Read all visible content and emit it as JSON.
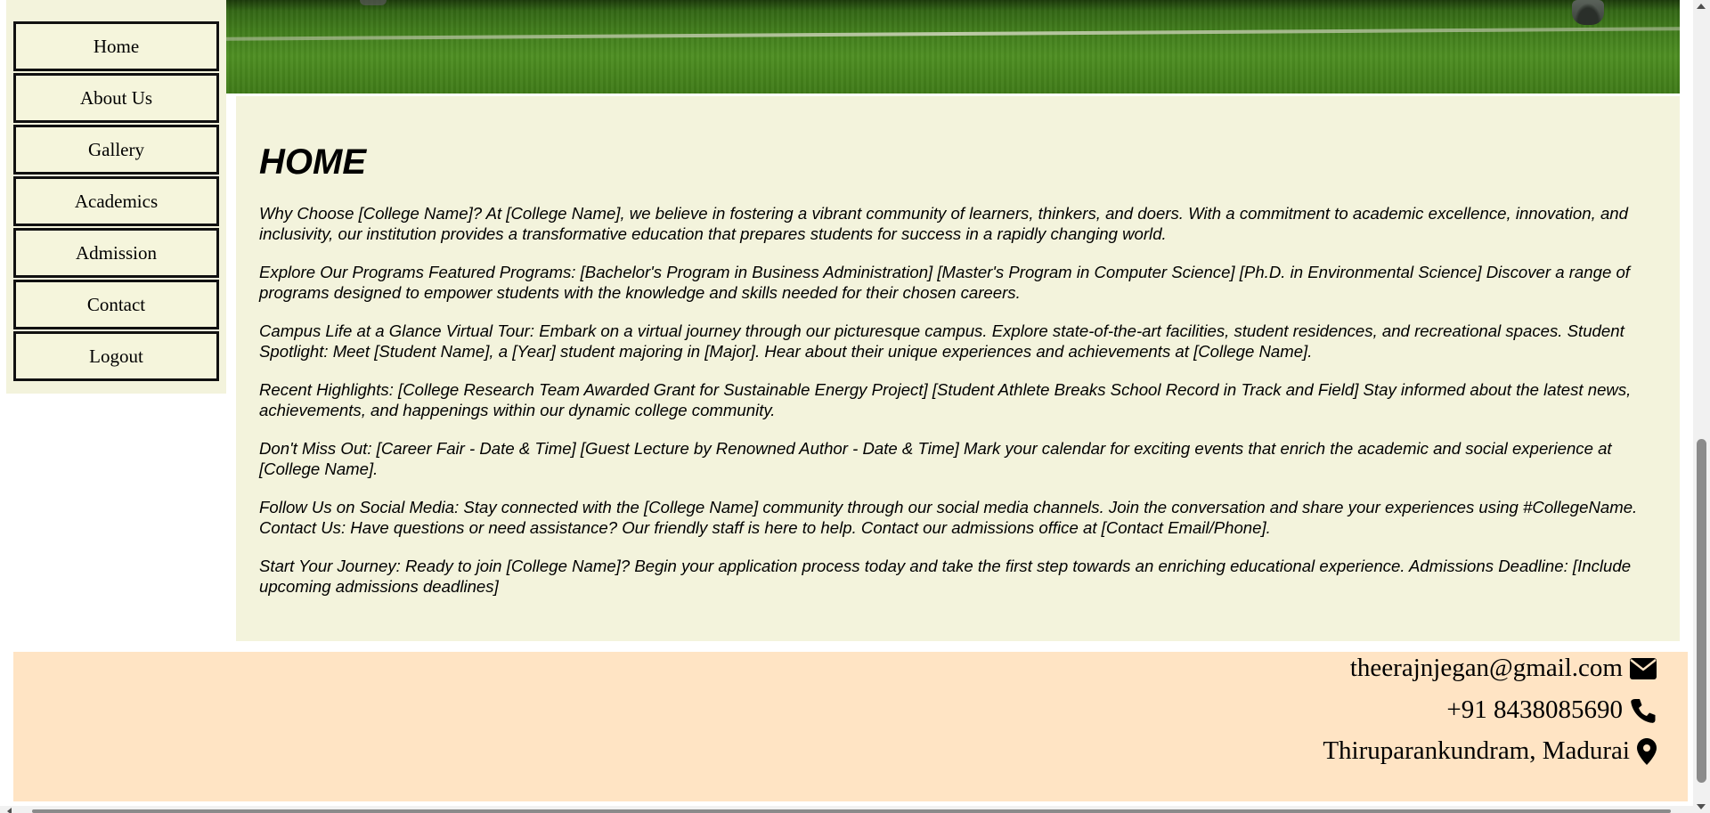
{
  "nav": {
    "items": [
      {
        "label": "Home"
      },
      {
        "label": "About Us"
      },
      {
        "label": "Gallery"
      },
      {
        "label": "Academics"
      },
      {
        "label": "Admission"
      },
      {
        "label": "Contact"
      },
      {
        "label": "Logout"
      }
    ]
  },
  "main": {
    "title": "HOME",
    "paragraphs": [
      "Why Choose [College Name]? At [College Name], we believe in fostering a vibrant community of learners, thinkers, and doers. With a commitment to academic excellence, innovation, and inclusivity, our institution provides a transformative education that prepares students for success in a rapidly changing world.",
      "Explore Our Programs Featured Programs: [Bachelor's Program in Business Administration] [Master's Program in Computer Science] [Ph.D. in Environmental Science] Discover a range of programs designed to empower students with the knowledge and skills needed for their chosen careers.",
      "Campus Life at a Glance Virtual Tour: Embark on a virtual journey through our picturesque campus. Explore state-of-the-art facilities, student residences, and recreational spaces. Student Spotlight: Meet [Student Name], a [Year] student majoring in [Major]. Hear about their unique experiences and achievements at [College Name].",
      "Recent Highlights: [College Research Team Awarded Grant for Sustainable Energy Project] [Student Athlete Breaks School Record in Track and Field] Stay informed about the latest news, achievements, and happenings within our dynamic college community.",
      "Don't Miss Out: [Career Fair - Date & Time] [Guest Lecture by Renowned Author - Date & Time] Mark your calendar for exciting events that enrich the academic and social experience at [College Name].",
      "Follow Us on Social Media: Stay connected with the [College Name] community through our social media channels. Join the conversation and share your experiences using #CollegeName. Contact Us: Have questions or need assistance? Our friendly staff is here to help. Contact our admissions office at [Contact Email/Phone].",
      "Start Your Journey: Ready to join [College Name]? Begin your application process today and take the first step towards an enriching educational experience. Admissions Deadline: [Include upcoming admissions deadlines]"
    ]
  },
  "footer": {
    "email": "theerajnjegan@gmail.com",
    "email_icon": "envelope-icon",
    "phone": "+91 8438085690",
    "phone_icon": "phone-icon",
    "location": "Thiruparankundram, Madurai",
    "location_icon": "map-marker-icon"
  },
  "colors": {
    "content_bg": "#f3f3dc",
    "footer_bg": "#ffe4c4"
  }
}
